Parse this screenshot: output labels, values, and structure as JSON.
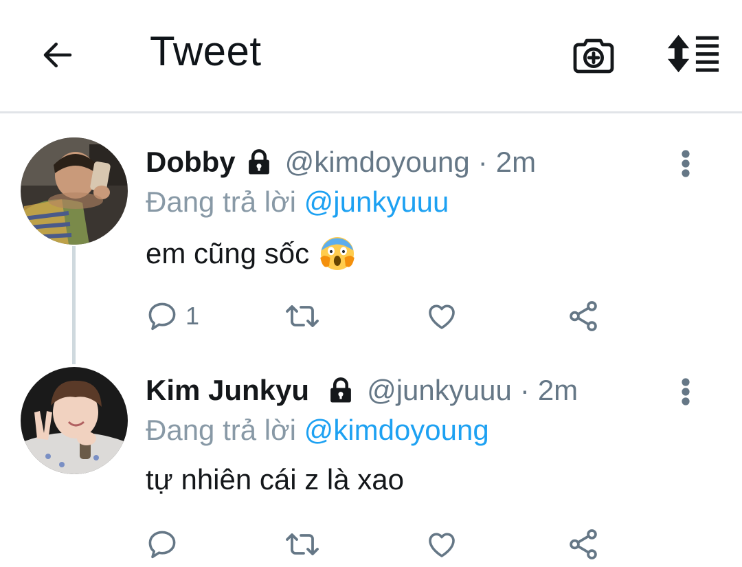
{
  "header": {
    "title": "Tweet",
    "back_icon": "arrow-left-icon",
    "camera_icon": "camera-plus-icon",
    "sort_icon": "sort-thread-icon"
  },
  "colors": {
    "link": "#1da1f2",
    "muted": "#657786",
    "reply_muted": "#8899a6",
    "text": "#14171a",
    "thread_line": "#cfd9de"
  },
  "tweets": [
    {
      "name": "Dobby",
      "protected_icon": "lock-icon",
      "handle": "@kimdoyoung",
      "separator": "·",
      "time": "2m",
      "reply_prefix": "Đang trả lời",
      "reply_to": "@junkyuuu",
      "text": "em cũng sốc",
      "emoji": "face-screaming-in-fear-emoji",
      "reply_count": "1",
      "retweet_count": "",
      "like_count": ""
    },
    {
      "name": "Kim Junkyu",
      "protected_icon": "lock-icon",
      "handle": "@junkyuuu",
      "separator": "·",
      "time": "2m",
      "reply_prefix": "Đang trả lời",
      "reply_to": "@kimdoyoung",
      "text": "tự nhiên cái z là xao",
      "reply_count": "",
      "retweet_count": "",
      "like_count": ""
    }
  ]
}
